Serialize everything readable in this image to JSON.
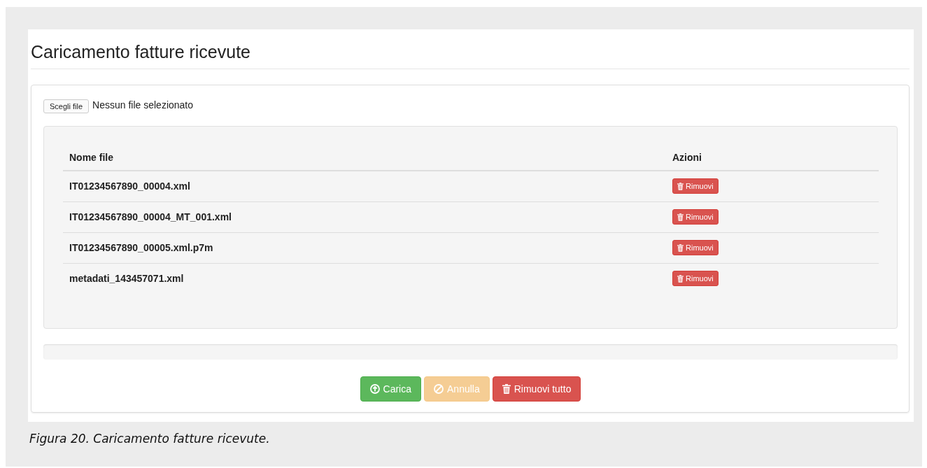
{
  "page": {
    "title": "Caricamento fatture ricevute"
  },
  "file_input": {
    "button": "Scegli file",
    "status": "Nessun file selezionato"
  },
  "table": {
    "columns": [
      "Nome file",
      "Azioni"
    ],
    "rows": [
      {
        "name": "IT01234567890_00004.xml",
        "action": "Rimuovi"
      },
      {
        "name": "IT01234567890_00004_MT_001.xml",
        "action": "Rimuovi"
      },
      {
        "name": "IT01234567890_00005.xml.p7m",
        "action": "Rimuovi"
      },
      {
        "name": "metadati_143457071.xml",
        "action": "Rimuovi"
      }
    ]
  },
  "progress": {
    "level": 0
  },
  "buttons": [
    {
      "label": "Carica",
      "kind": "upload",
      "disabled": false
    },
    {
      "label": "Annulla",
      "kind": "cancel",
      "disabled": true
    },
    {
      "label": "Rimuovi tutto",
      "kind": "remove",
      "disabled": false
    }
  ],
  "caption": "Figura 20. Caricamento fatture ricevute."
}
